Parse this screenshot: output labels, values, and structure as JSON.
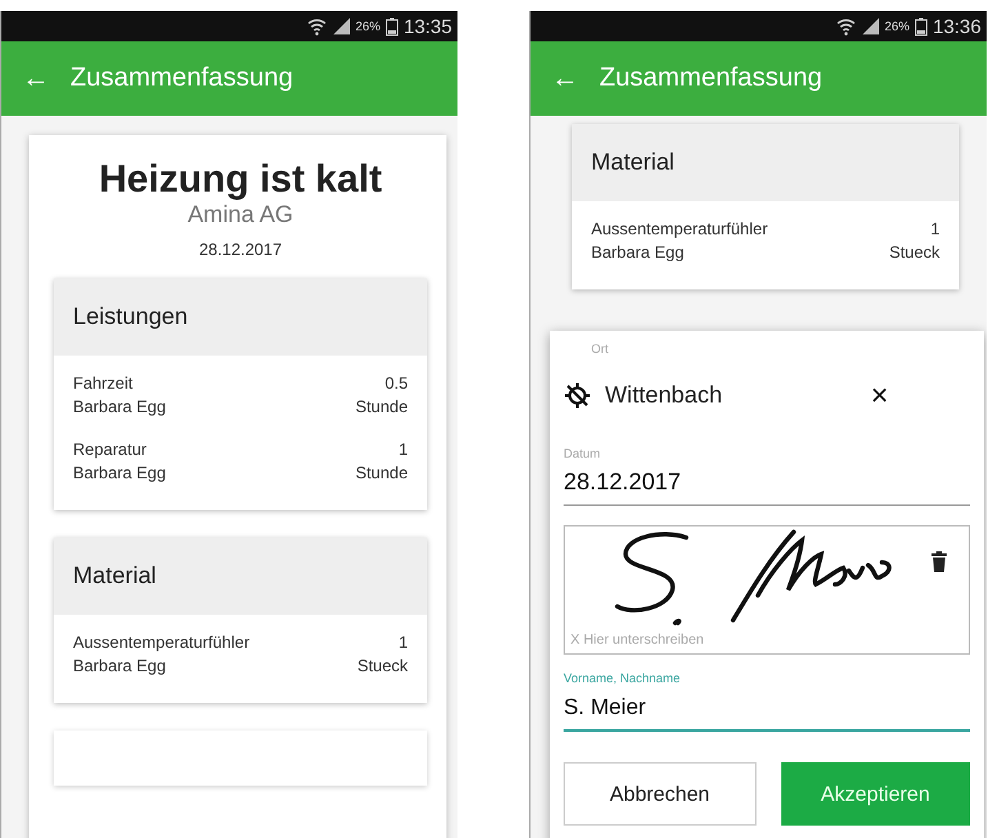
{
  "screens": [
    {
      "status_bar": {
        "battery": "26%",
        "time": "13:35"
      },
      "app_bar": {
        "back": "←",
        "title": "Zusammenfassung"
      },
      "summary": {
        "title": "Heizung ist kalt",
        "customer": "Amina AG",
        "date": "28.12.2017"
      },
      "sections": [
        {
          "title": "Leistungen",
          "items": [
            {
              "name": "Fahrzeit",
              "person": "Barbara Egg",
              "quantity": "0.5",
              "unit": "Stunde"
            },
            {
              "name": "Reparatur",
              "person": "Barbara Egg",
              "quantity": "1",
              "unit": "Stunde"
            }
          ]
        },
        {
          "title": "Material",
          "items": [
            {
              "name": "Aussentemperaturfühler",
              "person": "Barbara Egg",
              "quantity": "1",
              "unit": "Stueck"
            }
          ]
        }
      ]
    },
    {
      "status_bar": {
        "battery": "26%",
        "time": "13:36"
      },
      "app_bar": {
        "back": "←",
        "title": "Zusammenfassung"
      },
      "sections": [
        {
          "title": "Material",
          "items": [
            {
              "name": "Aussentemperaturfühler",
              "person": "Barbara Egg",
              "quantity": "1",
              "unit": "Stueck"
            }
          ]
        }
      ],
      "dialog": {
        "location": {
          "label": "Ort",
          "value": "Wittenbach",
          "clear": "×"
        },
        "date": {
          "label": "Datum",
          "value": "28.12.2017"
        },
        "signature": {
          "placeholder": "X Hier unterschreiben"
        },
        "name": {
          "label": "Vorname, Nachname",
          "value": "S. Meier"
        },
        "buttons": [
          {
            "label": "Abbrechen",
            "kind": "outlined"
          },
          {
            "label": "Akzeptieren",
            "kind": "primary"
          }
        ]
      }
    }
  ]
}
